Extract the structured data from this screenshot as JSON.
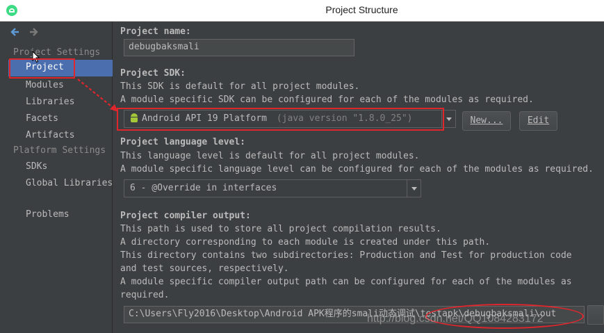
{
  "window": {
    "title": "Project Structure"
  },
  "sidebar": {
    "project_settings_header": "Project Settings",
    "project_settings_items": [
      "Project",
      "Modules",
      "Libraries",
      "Facets",
      "Artifacts"
    ],
    "platform_settings_header": "Platform Settings",
    "platform_settings_items": [
      "SDKs",
      "Global Libraries"
    ],
    "problems": "Problems",
    "selected": "Project"
  },
  "main": {
    "project_name": {
      "label": "Project name:",
      "value": "debugbaksmali"
    },
    "project_sdk": {
      "label": "Project SDK:",
      "desc1": "This SDK is default for all project modules.",
      "desc2": "A module specific SDK can be configured for each of the modules as required.",
      "selected": "Android API 19 Platform",
      "version": "(java version \"1.8.0_25\")",
      "new_button": "New...",
      "edit_button": "Edit"
    },
    "language_level": {
      "label": "Project language level:",
      "desc1": "This language level is default for all project modules.",
      "desc2": "A module specific language level can be configured for each of the modules as required.",
      "selected": "6 - @Override in interfaces"
    },
    "compiler_output": {
      "label": "Project compiler output:",
      "desc1": "This path is used to store all project compilation results.",
      "desc2": "A directory corresponding to each module is created under this path.",
      "desc3": "This directory contains two subdirectories: Production and Test for production code",
      "desc4": "and test sources, respectively.",
      "desc5": "A module specific compiler output path can be configured for each of the modules as",
      "desc6": "required.",
      "path": "C:\\Users\\Fly2016\\Desktop\\Android APK程序的smali动态调试\\testapk\\debugbaksmali\\out"
    }
  },
  "watermark": "http://blog.csdn.net/QQ1084283172",
  "colors": {
    "annotation": "#e0262d",
    "selection": "#4b6eaf",
    "background": "#3c3f41"
  },
  "icons": [
    "android-studio-icon",
    "back-arrow-icon",
    "forward-arrow-icon",
    "android-icon",
    "mouse-cursor-icon"
  ]
}
